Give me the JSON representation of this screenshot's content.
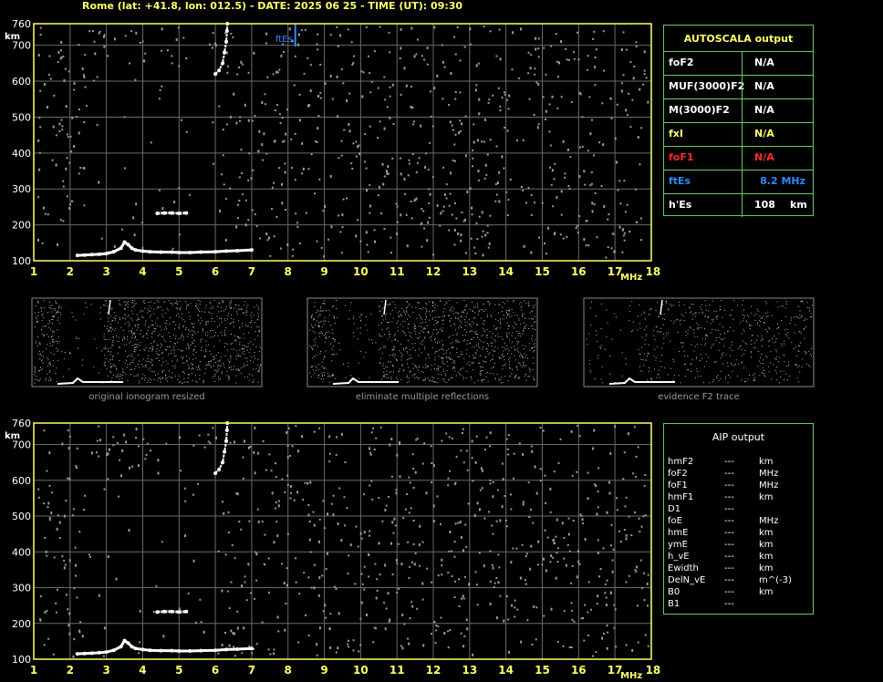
{
  "header": {
    "text": "Rome (lat: +41.8, lon: 012.5) - DATE: 2025 06 25 - TIME (UT): 09:30"
  },
  "colors": {
    "background": "#000000",
    "grid": "#6a6a6a",
    "frame": "#ffff66",
    "label_yellow": "#ffff66",
    "table_border": "#66cc66",
    "foF1_red": "#ff2a2a",
    "ftEs_blue": "#2a8cff",
    "trace": "#ffffff",
    "noise": "#9a9a9a"
  },
  "chart_data": [
    {
      "type": "scatter",
      "title": "",
      "xlabel": "MHz",
      "ylabel": "km",
      "xlim": [
        1,
        18
      ],
      "ylim": [
        100,
        760
      ],
      "x_ticks": [
        "1",
        "2",
        "3",
        "4",
        "5",
        "6",
        "7",
        "8",
        "9",
        "10",
        "11",
        "12",
        "13",
        "14",
        "15",
        "16",
        "17",
        "18"
      ],
      "y_ticks": [
        "760",
        "700",
        "600",
        "500",
        "400",
        "300",
        "200",
        "100"
      ],
      "grid": true,
      "annotation": {
        "label": "ftEs",
        "x": 8.2
      },
      "series": [
        {
          "role": "E-layer trace",
          "x": [
            2.2,
            2.4,
            2.6,
            2.8,
            3.0,
            3.2,
            3.4,
            3.5,
            3.6,
            3.7,
            3.8,
            4.0,
            4.2,
            4.5,
            4.8,
            5.0,
            5.3,
            5.6,
            6.0,
            6.3,
            6.6,
            7.0
          ],
          "y": [
            115,
            116,
            117,
            118,
            120,
            125,
            135,
            152,
            145,
            135,
            130,
            127,
            125,
            124,
            124,
            123,
            123,
            124,
            125,
            127,
            128,
            130
          ]
        },
        {
          "role": "F-layer trace",
          "x": [
            6.0,
            6.1,
            6.2,
            6.25,
            6.3,
            6.32,
            6.33
          ],
          "y": [
            620,
            630,
            650,
            680,
            710,
            740,
            760
          ]
        },
        {
          "role": "Es echo",
          "x": [
            4.4,
            4.6,
            4.8,
            5.0,
            5.2
          ],
          "y": [
            232,
            233,
            233,
            232,
            233
          ]
        }
      ]
    },
    {
      "type": "scatter",
      "title": "",
      "xlabel": "MHz",
      "ylabel": "km",
      "xlim": [
        1,
        18
      ],
      "ylim": [
        100,
        760
      ],
      "x_ticks": [
        "1",
        "2",
        "3",
        "4",
        "5",
        "6",
        "7",
        "8",
        "9",
        "10",
        "11",
        "12",
        "13",
        "14",
        "15",
        "16",
        "17",
        "18"
      ],
      "y_ticks": [
        "760",
        "700",
        "600",
        "500",
        "400",
        "300",
        "200",
        "100"
      ],
      "grid": true,
      "series": [
        {
          "role": "E-layer trace",
          "x": [
            2.2,
            2.4,
            2.6,
            2.8,
            3.0,
            3.2,
            3.4,
            3.5,
            3.6,
            3.7,
            3.8,
            4.0,
            4.2,
            4.5,
            4.8,
            5.0,
            5.3,
            5.6,
            6.0,
            6.3,
            6.6,
            7.0
          ],
          "y": [
            115,
            116,
            117,
            118,
            120,
            125,
            135,
            152,
            145,
            135,
            130,
            127,
            125,
            124,
            124,
            123,
            123,
            124,
            125,
            127,
            128,
            130
          ]
        },
        {
          "role": "F-layer trace",
          "x": [
            6.0,
            6.1,
            6.2,
            6.25,
            6.3,
            6.32,
            6.33
          ],
          "y": [
            620,
            630,
            650,
            680,
            710,
            740,
            760
          ]
        },
        {
          "role": "Es echo",
          "x": [
            4.4,
            4.6,
            4.8,
            5.0,
            5.2
          ],
          "y": [
            232,
            233,
            233,
            232,
            233
          ]
        }
      ]
    }
  ],
  "thumbnails": [
    {
      "caption": "original ionogram resized"
    },
    {
      "caption": "eliminate multiple reflections"
    },
    {
      "caption": "evidence F2 trace"
    }
  ],
  "autoscala": {
    "title": "AUTOSCALA output",
    "rows": [
      {
        "label": "foF2",
        "value": "N/A",
        "unit": "",
        "color": "#ffffff"
      },
      {
        "label": "MUF(3000)F2",
        "value": "N/A",
        "unit": "",
        "color": "#ffffff"
      },
      {
        "label": "M(3000)F2",
        "value": "N/A",
        "unit": "",
        "color": "#ffffff"
      },
      {
        "label": "fxI",
        "value": "N/A",
        "unit": "",
        "color": "#ffff66"
      },
      {
        "label": "foF1",
        "value": "N/A",
        "unit": "",
        "color": "#ff2a2a"
      },
      {
        "label": "ftEs",
        "value": "8.2 MHz",
        "unit": "",
        "color": "#2a8cff"
      },
      {
        "label": "h'Es",
        "value": "108",
        "unit": "km",
        "color": "#ffffff"
      }
    ]
  },
  "aip": {
    "title": "AIP output",
    "rows": [
      {
        "label": "hmF2",
        "value": "---",
        "unit": "km"
      },
      {
        "label": "foF2",
        "value": "---",
        "unit": "MHz"
      },
      {
        "label": "foF1",
        "value": "---",
        "unit": "MHz"
      },
      {
        "label": "hmF1",
        "value": "---",
        "unit": "km"
      },
      {
        "label": "D1",
        "value": "---",
        "unit": ""
      },
      {
        "label": "foE",
        "value": "---",
        "unit": "MHz"
      },
      {
        "label": "hmE",
        "value": "---",
        "unit": "km"
      },
      {
        "label": "ymE",
        "value": "---",
        "unit": "km"
      },
      {
        "label": "h_vE",
        "value": "---",
        "unit": "km"
      },
      {
        "label": "Ewidth",
        "value": "---",
        "unit": "km"
      },
      {
        "label": "DelN_vE",
        "value": "---",
        "unit": "m^(-3)"
      },
      {
        "label": "B0",
        "value": "---",
        "unit": "km"
      },
      {
        "label": "B1",
        "value": "---",
        "unit": ""
      }
    ]
  }
}
